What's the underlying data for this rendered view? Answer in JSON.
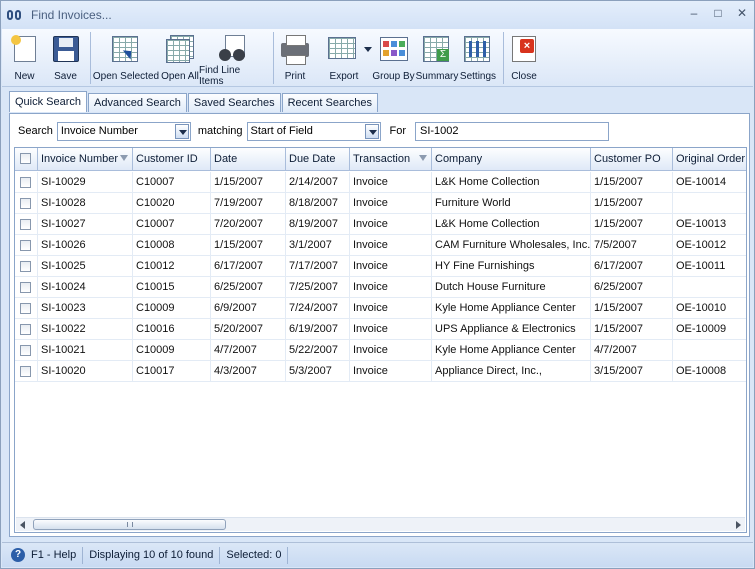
{
  "window": {
    "title": "Find Invoices..."
  },
  "toolbar": {
    "new": "New",
    "save": "Save",
    "open_selected": "Open Selected",
    "open_all": "Open All",
    "find_line_items": "Find Line Items",
    "print": "Print",
    "export": "Export",
    "group_by": "Group By",
    "summary": "Summary",
    "settings": "Settings",
    "close": "Close"
  },
  "tabs": [
    "Quick Search",
    "Advanced Search",
    "Saved Searches",
    "Recent Searches"
  ],
  "search": {
    "search_label": "Search",
    "field": "Invoice Number",
    "matching_label": "matching",
    "match": "Start of Field",
    "for_label": "For",
    "value": "SI-1002"
  },
  "grid": {
    "columns": [
      "Invoice Number",
      "Customer ID",
      "Date",
      "Due Date",
      "Transaction",
      "Company",
      "Customer PO",
      "Original Order"
    ],
    "rows": [
      [
        "SI-10029",
        "C10007",
        "1/15/2007",
        "2/14/2007",
        "Invoice",
        "L&K Home Collection",
        "1/15/2007",
        "OE-10014"
      ],
      [
        "SI-10028",
        "C10020",
        "7/19/2007",
        "8/18/2007",
        "Invoice",
        "Furniture World",
        "1/15/2007",
        ""
      ],
      [
        "SI-10027",
        "C10007",
        "7/20/2007",
        "8/19/2007",
        "Invoice",
        "L&K Home Collection",
        "1/15/2007",
        "OE-10013"
      ],
      [
        "SI-10026",
        "C10008",
        "1/15/2007",
        "3/1/2007",
        "Invoice",
        "CAM Furniture Wholesales, Inc.",
        "7/5/2007",
        "OE-10012"
      ],
      [
        "SI-10025",
        "C10012",
        "6/17/2007",
        "7/17/2007",
        "Invoice",
        "HY Fine Furnishings",
        "6/17/2007",
        "OE-10011"
      ],
      [
        "SI-10024",
        "C10015",
        "6/25/2007",
        "7/25/2007",
        "Invoice",
        "Dutch House Furniture",
        "6/25/2007",
        ""
      ],
      [
        "SI-10023",
        "C10009",
        "6/9/2007",
        "7/24/2007",
        "Invoice",
        "Kyle Home Appliance Center",
        "1/15/2007",
        "OE-10010"
      ],
      [
        "SI-10022",
        "C10016",
        "5/20/2007",
        "6/19/2007",
        "Invoice",
        "UPS Appliance & Electronics",
        "1/15/2007",
        "OE-10009"
      ],
      [
        "SI-10021",
        "C10009",
        "4/7/2007",
        "5/22/2007",
        "Invoice",
        "Kyle Home Appliance Center",
        "4/7/2007",
        ""
      ],
      [
        "SI-10020",
        "C10017",
        "4/3/2007",
        "5/3/2007",
        "Invoice",
        "Appliance Direct, Inc.,",
        "3/15/2007",
        "OE-10008"
      ]
    ]
  },
  "status": {
    "help": "F1 - Help",
    "displaying": "Displaying 10 of 10 found",
    "selected": "Selected: 0"
  }
}
